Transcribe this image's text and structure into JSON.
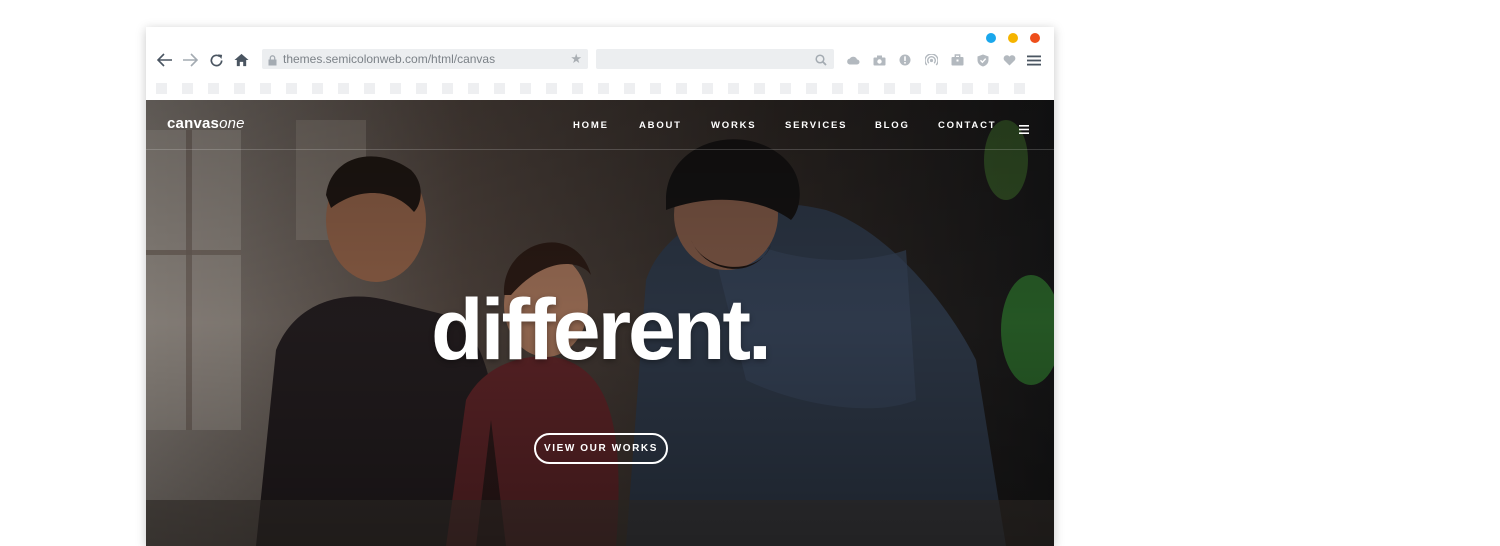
{
  "browser": {
    "traffic_lights": [
      "#1aa7ec",
      "#f5b400",
      "#ee4e1b"
    ],
    "back_icon": "back-arrow-icon",
    "forward_icon": "forward-arrow-icon",
    "reload_icon": "reload-icon",
    "home_icon": "home-icon",
    "url": "themes.semicolonweb.com/html/canvas",
    "search": {
      "value": "",
      "placeholder": ""
    },
    "extension_icons": [
      "cloud-icon",
      "camera-icon",
      "info-icon",
      "wifi-icon",
      "briefcase-icon",
      "shield-icon",
      "heart-icon",
      "menu-icon"
    ]
  },
  "site": {
    "logo": {
      "bold": "canvas",
      "italic": "one"
    },
    "nav": [
      "HOME",
      "ABOUT",
      "WORKS",
      "SERVICES",
      "BLOG",
      "CONTACT"
    ],
    "hero": {
      "title": "different.",
      "cta": "VIEW OUR WORKS"
    }
  },
  "colors": {
    "accent_blue": "#1aa7ec",
    "accent_yellow": "#f5b400",
    "accent_red": "#ee4e1b",
    "chrome_icon": "#4a5561",
    "chrome_field": "#eceef0"
  }
}
